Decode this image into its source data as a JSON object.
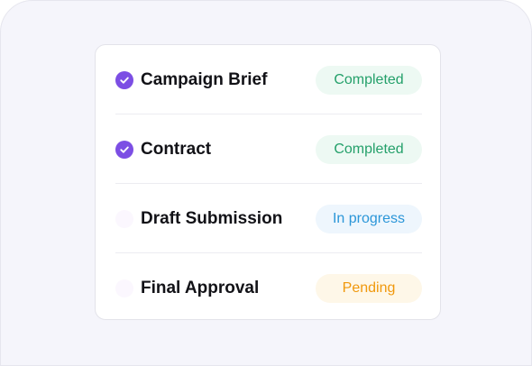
{
  "checklist": {
    "items": [
      {
        "label": "Campaign Brief",
        "status": "Completed",
        "checked": true
      },
      {
        "label": "Contract",
        "status": "Completed",
        "checked": true
      },
      {
        "label": "Draft Submission",
        "status": "In progress",
        "checked": false
      },
      {
        "label": "Final Approval",
        "status": "Pending",
        "checked": false
      }
    ]
  },
  "icons": {
    "checked": "check-circle-icon",
    "unchecked": "empty-circle-icon"
  },
  "colors": {
    "check_fill": "#7c4ee4",
    "completed_bg": "#edf9f3",
    "completed_text": "#24a06a",
    "in_progress_bg": "#eef6fd",
    "in_progress_text": "#2b96d8",
    "pending_bg": "#fef7e8",
    "pending_text": "#f0980c"
  }
}
